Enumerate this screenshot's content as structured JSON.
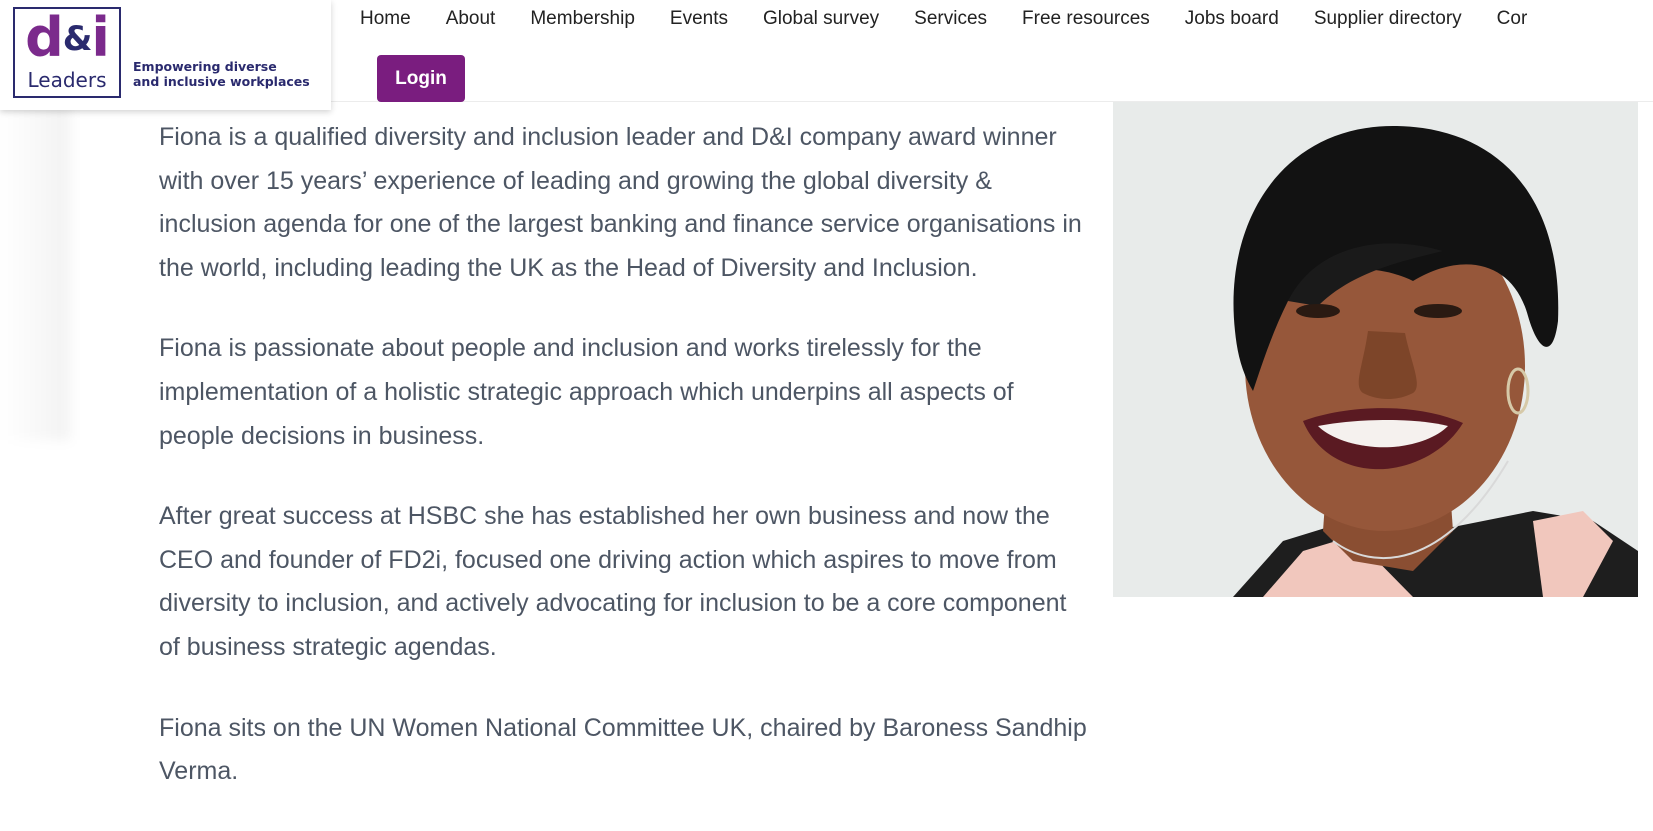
{
  "logo": {
    "main_d": "d",
    "main_amp": "&",
    "main_i": "i",
    "sub": "Leaders",
    "tagline_line1": "Empowering diverse",
    "tagline_line2": "and inclusive workplaces"
  },
  "nav": {
    "items": [
      "Home",
      "About",
      "Membership",
      "Events",
      "Global survey",
      "Services",
      "Free resources",
      "Jobs board",
      "Supplier directory",
      "Cor"
    ],
    "login_label": "Login"
  },
  "bio": {
    "paragraphs": [
      "Fiona is a qualified diversity and inclusion leader and D&I company award winner with over 15 years’ experience of leading and growing the global diversity & inclusion agenda for one of the largest banking and finance service organisations in the world, including leading the UK as the Head of Diversity and Inclusion.",
      "Fiona is passionate about people and inclusion and works tirelessly for the implementation of a holistic strategic approach which underpins all aspects of people decisions in business.",
      "After great success at HSBC she has established her own business and now the CEO and founder of FD2i, focused one driving action which aspires to move from diversity to inclusion, and actively advocating for inclusion to be a core component of business strategic agendas.",
      "Fiona sits on the UN Women National Committee UK, chaired by Baroness Sandhip Verma."
    ]
  },
  "colors": {
    "brand_purple": "#7a1d7f",
    "brand_navy": "#2a2a6e",
    "body_text": "#4d5664"
  }
}
